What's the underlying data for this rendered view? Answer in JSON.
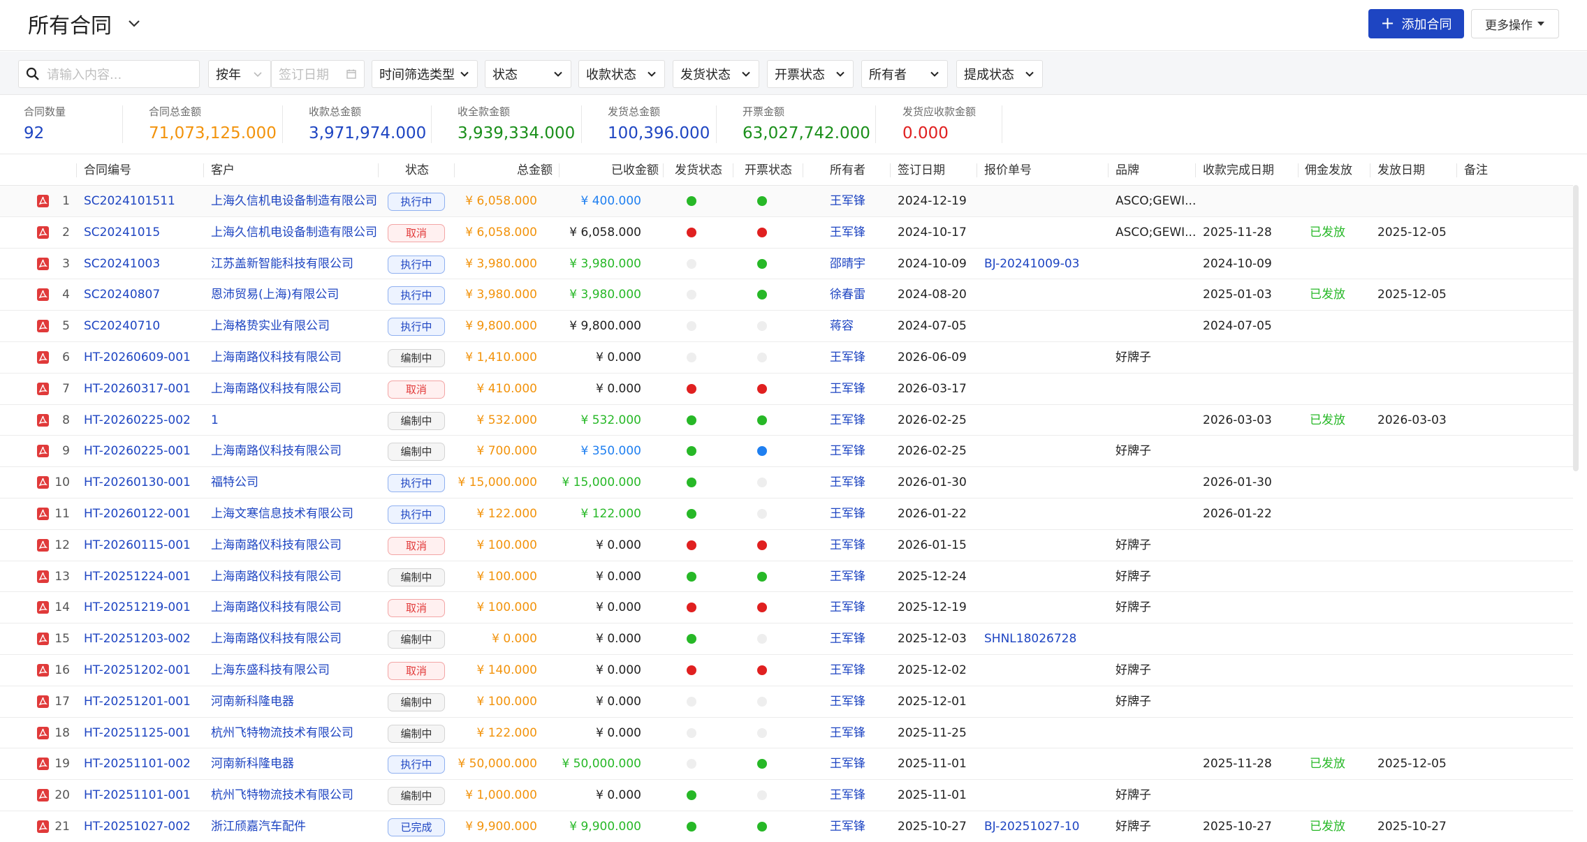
{
  "header": {
    "title": "所有合同",
    "add_label": "添加合同",
    "more_label": "更多操作"
  },
  "filters": {
    "search_placeholder": "请输入内容...",
    "period": "按年",
    "date_placeholder": "签订日期",
    "time_type": "时间筛选类型",
    "status": "状态",
    "receipt_status": "收款状态",
    "shipping_status": "发货状态",
    "invoice_status": "开票状态",
    "owner": "所有者",
    "submit_status": "提成状态"
  },
  "summary": [
    {
      "label": "合同数量",
      "value": "92",
      "color": "#1e45c2"
    },
    {
      "label": "合同总金额",
      "value": "71,073,125.000",
      "color": "#f2930c"
    },
    {
      "label": "收款总金额",
      "value": "3,971,974.000",
      "color": "#1e45c2"
    },
    {
      "label": "收全款金额",
      "value": "3,939,334.000",
      "color": "#1a8f1a"
    },
    {
      "label": "发货总金额",
      "value": "100,396.000",
      "color": "#1e45c2"
    },
    {
      "label": "开票金额",
      "value": "63,027,742.000",
      "color": "#1a8f1a"
    },
    {
      "label": "发货应收款金额",
      "value": "0.000",
      "color": "#e02020"
    }
  ],
  "columns": [
    "合同编号",
    "客户",
    "状态",
    "总金额",
    "已收金额",
    "发货状态",
    "开票状态",
    "所有者",
    "签订日期",
    "报价单号",
    "品牌",
    "收款完成日期",
    "佣金发放",
    "发放日期",
    "备注"
  ],
  "rows": [
    {
      "idx": "1",
      "code": "SC2024101511",
      "customer": "上海久信机电设备制造有限公司",
      "status": "执行中",
      "st": "exec",
      "total": "¥ 6,058.000",
      "received": "¥ 400.000",
      "rc": "#1f7ff0",
      "ship": "green",
      "inv": "green",
      "owner": "王军锋",
      "sign_date": "2024-12-19",
      "quote": "",
      "brand": "ASCO;GEWI...",
      "complete_date": "",
      "commission": "",
      "pay_date": ""
    },
    {
      "idx": "2",
      "code": "SC20241015",
      "customer": "上海久信机电设备制造有限公司",
      "status": "取消",
      "st": "cancel",
      "total": "¥ 6,058.000",
      "received": "¥ 6,058.000",
      "rc": "#222",
      "ship": "red",
      "inv": "red",
      "owner": "王军锋",
      "sign_date": "2024-10-17",
      "quote": "",
      "brand": "ASCO;GEWI...",
      "complete_date": "2025-11-28",
      "commission": "已发放",
      "pay_date": "2025-12-05"
    },
    {
      "idx": "3",
      "code": "SC20241003",
      "customer": "江苏盖新智能科技有限公司",
      "status": "执行中",
      "st": "exec",
      "total": "¥ 3,980.000",
      "received": "¥ 3,980.000",
      "rc": "#27b827",
      "ship": "grey",
      "inv": "green",
      "owner": "邵晴宇",
      "sign_date": "2024-10-09",
      "quote": "BJ-20241009-03",
      "brand": "",
      "complete_date": "2024-10-09",
      "commission": "",
      "pay_date": ""
    },
    {
      "idx": "4",
      "code": "SC20240807",
      "customer": "恩沛贸易(上海)有限公司",
      "status": "执行中",
      "st": "exec",
      "total": "¥ 3,980.000",
      "received": "¥ 3,980.000",
      "rc": "#27b827",
      "ship": "grey",
      "inv": "green",
      "owner": "徐春雷",
      "sign_date": "2024-08-20",
      "quote": "",
      "brand": "",
      "complete_date": "2025-01-03",
      "commission": "已发放",
      "pay_date": "2025-12-05"
    },
    {
      "idx": "5",
      "code": "SC20240710",
      "customer": "上海格贽实业有限公司",
      "status": "执行中",
      "st": "exec",
      "total": "¥ 9,800.000",
      "received": "¥ 9,800.000",
      "rc": "#222",
      "ship": "grey",
      "inv": "grey",
      "owner": "蒋容",
      "sign_date": "2024-07-05",
      "quote": "",
      "brand": "",
      "complete_date": "2024-07-05",
      "commission": "",
      "pay_date": ""
    },
    {
      "idx": "6",
      "code": "HT-20260609-001",
      "customer": "上海南路仪科技有限公司",
      "status": "编制中",
      "st": "draft",
      "total": "¥ 1,410.000",
      "received": "¥ 0.000",
      "rc": "#222",
      "ship": "grey",
      "inv": "grey",
      "owner": "王军锋",
      "sign_date": "2026-06-09",
      "quote": "",
      "brand": "好牌子",
      "complete_date": "",
      "commission": "",
      "pay_date": ""
    },
    {
      "idx": "7",
      "code": "HT-20260317-001",
      "customer": "上海南路仪科技有限公司",
      "status": "取消",
      "st": "cancel",
      "total": "¥ 410.000",
      "received": "¥ 0.000",
      "rc": "#222",
      "ship": "red",
      "inv": "red",
      "owner": "王军锋",
      "sign_date": "2026-03-17",
      "quote": "",
      "brand": "",
      "complete_date": "",
      "commission": "",
      "pay_date": ""
    },
    {
      "idx": "8",
      "code": "HT-20260225-002",
      "customer": "1",
      "status": "编制中",
      "st": "draft",
      "total": "¥ 532.000",
      "received": "¥ 532.000",
      "rc": "#27b827",
      "ship": "green",
      "inv": "green",
      "owner": "王军锋",
      "sign_date": "2026-02-25",
      "quote": "",
      "brand": "",
      "complete_date": "2026-03-03",
      "commission": "已发放",
      "pay_date": "2026-03-03"
    },
    {
      "idx": "9",
      "code": "HT-20260225-001",
      "customer": "上海南路仪科技有限公司",
      "status": "编制中",
      "st": "draft",
      "total": "¥ 700.000",
      "received": "¥ 350.000",
      "rc": "#1f7ff0",
      "ship": "green",
      "inv": "blue",
      "owner": "王军锋",
      "sign_date": "2026-02-25",
      "quote": "",
      "brand": "好牌子",
      "complete_date": "",
      "commission": "",
      "pay_date": ""
    },
    {
      "idx": "10",
      "code": "HT-20260130-001",
      "customer": "福特公司",
      "status": "执行中",
      "st": "exec",
      "total": "¥ 15,000.000",
      "received": "¥ 15,000.000",
      "rc": "#27b827",
      "ship": "green",
      "inv": "grey",
      "owner": "王军锋",
      "sign_date": "2026-01-30",
      "quote": "",
      "brand": "",
      "complete_date": "2026-01-30",
      "commission": "",
      "pay_date": ""
    },
    {
      "idx": "11",
      "code": "HT-20260122-001",
      "customer": "上海文寒信息技术有限公司",
      "status": "执行中",
      "st": "exec",
      "total": "¥ 122.000",
      "received": "¥ 122.000",
      "rc": "#27b827",
      "ship": "green",
      "inv": "grey",
      "owner": "王军锋",
      "sign_date": "2026-01-22",
      "quote": "",
      "brand": "",
      "complete_date": "2026-01-22",
      "commission": "",
      "pay_date": ""
    },
    {
      "idx": "12",
      "code": "HT-20260115-001",
      "customer": "上海南路仪科技有限公司",
      "status": "取消",
      "st": "cancel",
      "total": "¥ 100.000",
      "received": "¥ 0.000",
      "rc": "#222",
      "ship": "red",
      "inv": "red",
      "owner": "王军锋",
      "sign_date": "2026-01-15",
      "quote": "",
      "brand": "好牌子",
      "complete_date": "",
      "commission": "",
      "pay_date": ""
    },
    {
      "idx": "13",
      "code": "HT-20251224-001",
      "customer": "上海南路仪科技有限公司",
      "status": "编制中",
      "st": "draft",
      "total": "¥ 100.000",
      "received": "¥ 0.000",
      "rc": "#222",
      "ship": "green",
      "inv": "green",
      "owner": "王军锋",
      "sign_date": "2025-12-24",
      "quote": "",
      "brand": "好牌子",
      "complete_date": "",
      "commission": "",
      "pay_date": ""
    },
    {
      "idx": "14",
      "code": "HT-20251219-001",
      "customer": "上海南路仪科技有限公司",
      "status": "取消",
      "st": "cancel",
      "total": "¥ 100.000",
      "received": "¥ 0.000",
      "rc": "#222",
      "ship": "red",
      "inv": "red",
      "owner": "王军锋",
      "sign_date": "2025-12-19",
      "quote": "",
      "brand": "好牌子",
      "complete_date": "",
      "commission": "",
      "pay_date": ""
    },
    {
      "idx": "15",
      "code": "HT-20251203-002",
      "customer": "上海南路仪科技有限公司",
      "status": "编制中",
      "st": "draft",
      "total": "¥ 0.000",
      "received": "¥ 0.000",
      "rc": "#222",
      "ship": "green",
      "inv": "grey",
      "owner": "王军锋",
      "sign_date": "2025-12-03",
      "quote": "SHNL18026728",
      "brand": "",
      "complete_date": "",
      "commission": "",
      "pay_date": ""
    },
    {
      "idx": "16",
      "code": "HT-20251202-001",
      "customer": "上海东盛科技有限公司",
      "status": "取消",
      "st": "cancel",
      "total": "¥ 140.000",
      "received": "¥ 0.000",
      "rc": "#222",
      "ship": "red",
      "inv": "red",
      "owner": "王军锋",
      "sign_date": "2025-12-02",
      "quote": "",
      "brand": "好牌子",
      "complete_date": "",
      "commission": "",
      "pay_date": ""
    },
    {
      "idx": "17",
      "code": "HT-20251201-001",
      "customer": "河南新科隆电器",
      "status": "编制中",
      "st": "draft",
      "total": "¥ 100.000",
      "received": "¥ 0.000",
      "rc": "#222",
      "ship": "grey",
      "inv": "grey",
      "owner": "王军锋",
      "sign_date": "2025-12-01",
      "quote": "",
      "brand": "好牌子",
      "complete_date": "",
      "commission": "",
      "pay_date": ""
    },
    {
      "idx": "18",
      "code": "HT-20251125-001",
      "customer": "杭州飞特物流技术有限公司",
      "status": "编制中",
      "st": "draft",
      "total": "¥ 122.000",
      "received": "¥ 0.000",
      "rc": "#222",
      "ship": "grey",
      "inv": "grey",
      "owner": "王军锋",
      "sign_date": "2025-11-25",
      "quote": "",
      "brand": "",
      "complete_date": "",
      "commission": "",
      "pay_date": ""
    },
    {
      "idx": "19",
      "code": "HT-20251101-002",
      "customer": "河南新科隆电器",
      "status": "执行中",
      "st": "exec",
      "total": "¥ 50,000.000",
      "received": "¥ 50,000.000",
      "rc": "#27b827",
      "ship": "grey",
      "inv": "green",
      "owner": "王军锋",
      "sign_date": "2025-11-01",
      "quote": "",
      "brand": "",
      "complete_date": "2025-11-28",
      "commission": "已发放",
      "pay_date": "2025-12-05"
    },
    {
      "idx": "20",
      "code": "HT-20251101-001",
      "customer": "杭州飞特物流技术有限公司",
      "status": "编制中",
      "st": "draft",
      "total": "¥ 1,000.000",
      "received": "¥ 0.000",
      "rc": "#222",
      "ship": "green",
      "inv": "grey",
      "owner": "王军锋",
      "sign_date": "2025-11-01",
      "quote": "",
      "brand": "好牌子",
      "complete_date": "",
      "commission": "",
      "pay_date": ""
    },
    {
      "idx": "21",
      "code": "HT-20251027-002",
      "customer": "浙江颀嘉汽车配件",
      "status": "已完成",
      "st": "done",
      "total": "¥ 9,900.000",
      "received": "¥ 9,900.000",
      "rc": "#27b827",
      "ship": "green",
      "inv": "green",
      "owner": "王军锋",
      "sign_date": "2025-10-27",
      "quote": "BJ-20251027-10",
      "brand": "好牌子",
      "complete_date": "2025-10-27",
      "commission": "已发放",
      "pay_date": "2025-10-27"
    }
  ]
}
